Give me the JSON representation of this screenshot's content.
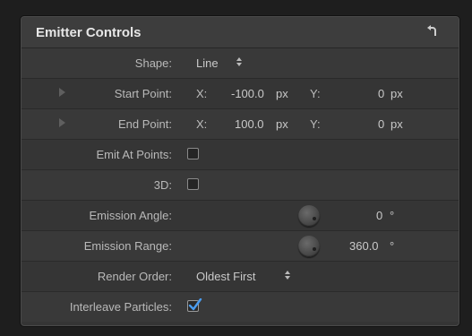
{
  "panel": {
    "title": "Emitter Controls",
    "reset_icon": "reset-arrow-icon"
  },
  "rows": {
    "shape": {
      "label": "Shape:",
      "value": "Line"
    },
    "start_point": {
      "label": "Start Point:",
      "x_label": "X:",
      "x_value": "-100.0",
      "x_unit": "px",
      "y_label": "Y:",
      "y_value": "0",
      "y_unit": "px"
    },
    "end_point": {
      "label": "End Point:",
      "x_label": "X:",
      "x_value": "100.0",
      "x_unit": "px",
      "y_label": "Y:",
      "y_value": "0",
      "y_unit": "px"
    },
    "emit_at_points": {
      "label": "Emit At Points:",
      "checked": false
    },
    "three_d": {
      "label": "3D:",
      "checked": false
    },
    "emission_angle": {
      "label": "Emission Angle:",
      "value": "0",
      "unit": "°"
    },
    "emission_range": {
      "label": "Emission Range:",
      "value": "360.0",
      "unit": "°"
    },
    "render_order": {
      "label": "Render Order:",
      "value": "Oldest First"
    },
    "interleave_particles": {
      "label": "Interleave Particles:",
      "checked": true
    }
  }
}
